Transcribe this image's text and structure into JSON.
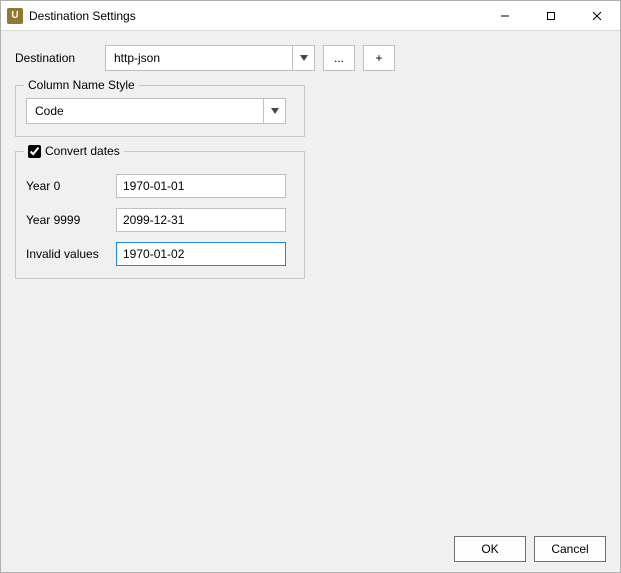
{
  "window": {
    "title": "Destination Settings"
  },
  "destination": {
    "label": "Destination",
    "selected": "http-json",
    "browse_label": "...",
    "add_label": "+"
  },
  "column_style": {
    "legend": "Column Name Style",
    "selected": "Code"
  },
  "convert_dates": {
    "legend": "Convert dates",
    "checked": true,
    "year0_label": "Year 0",
    "year0_value": "1970-01-01",
    "year9999_label": "Year 9999",
    "year9999_value": "2099-12-31",
    "invalid_label": "Invalid values",
    "invalid_value": "1970-01-02"
  },
  "footer": {
    "ok": "OK",
    "cancel": "Cancel"
  }
}
